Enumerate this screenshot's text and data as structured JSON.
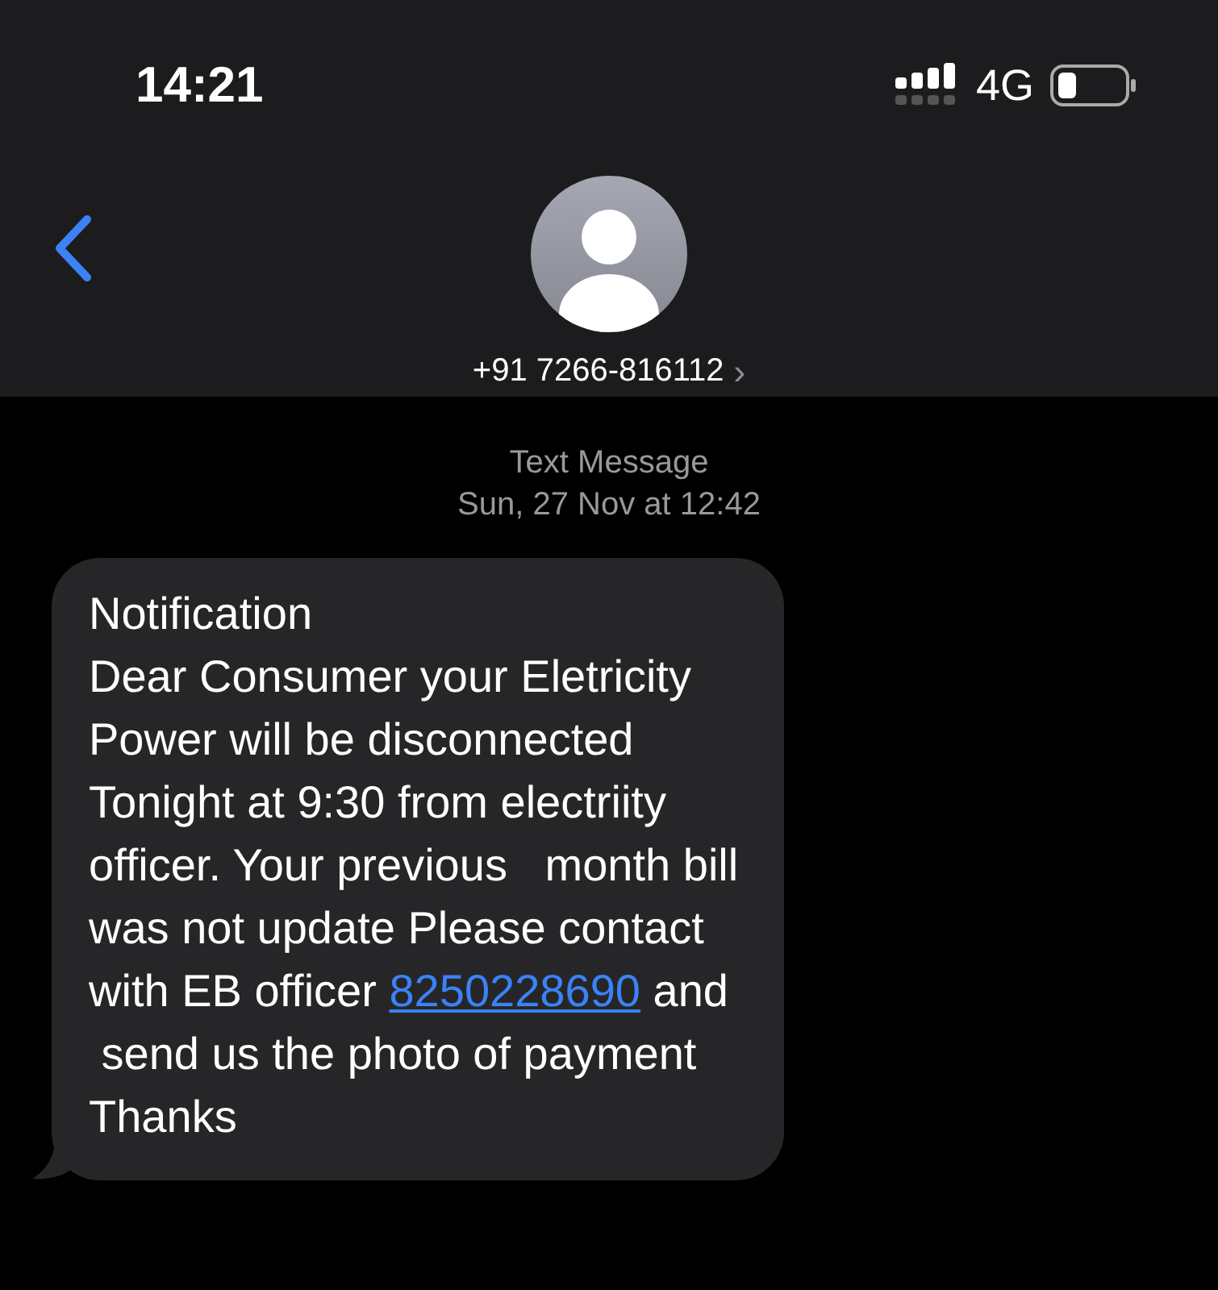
{
  "status_bar": {
    "time": "14:21",
    "network": "4G"
  },
  "header": {
    "contact": "+91 7266-816112",
    "chevron": "›"
  },
  "thread": {
    "label": "Text Message",
    "timestamp": "Sun, 27 Nov at 12:42"
  },
  "message": {
    "lines": [
      {
        "text": "Notification"
      },
      {
        "text": "Dear Consumer your Eletricity"
      },
      {
        "text": "Power will be disconnected"
      },
      {
        "text": "Tonight at 9:30 from electriity"
      },
      {
        "text": "officer. Your previous   month bill"
      },
      {
        "text": "was not update Please contact"
      },
      {
        "text": "with EB officer ",
        "link": "8250228690",
        "after": " and"
      },
      {
        "text": " send us the photo of payment"
      },
      {
        "text": "Thanks"
      }
    ]
  }
}
